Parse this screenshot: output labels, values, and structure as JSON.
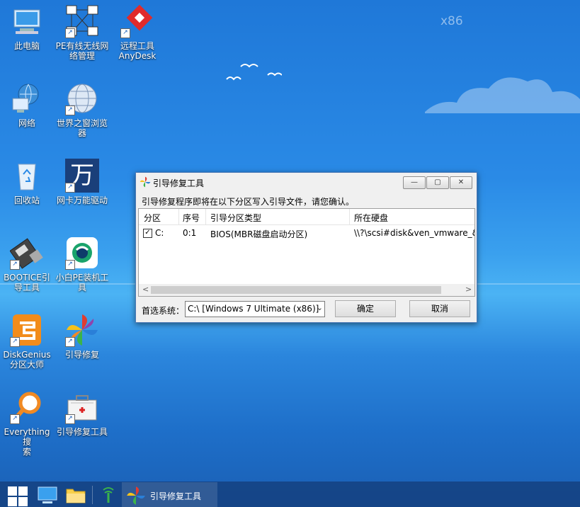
{
  "desktop": {
    "watermark": "x86",
    "icons": [
      {
        "label1": "此电脑",
        "label2": ""
      },
      {
        "label1": "PE有线无线网",
        "label2": "络管理"
      },
      {
        "label1": "远程工具",
        "label2": "AnyDesk"
      },
      {
        "label1": "网络",
        "label2": ""
      },
      {
        "label1": "世界之窗浏览",
        "label2": "器"
      },
      {
        "label1": "回收站",
        "label2": ""
      },
      {
        "label1": "网卡万能驱动",
        "label2": ""
      },
      {
        "label1": "BOOTICE引",
        "label2": "导工具"
      },
      {
        "label1": "小白PE装机工",
        "label2": "具"
      },
      {
        "label1": "DiskGenius",
        "label2": "分区大师"
      },
      {
        "label1": "引导修复",
        "label2": ""
      },
      {
        "label1": "Everything搜",
        "label2": "索"
      },
      {
        "label1": "引导修复工具",
        "label2": ""
      }
    ],
    "wan_glyph": "万"
  },
  "dialog": {
    "title": "引导修复工具",
    "prompt": "引导修复程序即将在以下分区写入引导文件，请您确认。",
    "columns": [
      "分区",
      "序号",
      "引导分区类型",
      "所在硬盘"
    ],
    "rows": [
      {
        "partition": "C:",
        "index": "0:1",
        "type": "BIOS(MBR磁盘启动分区)",
        "disk": "\\\\?\\scsi#disk&ven_vmware_&",
        "checked": true
      }
    ],
    "preferred_label": "首选系统：",
    "preferred_value": "C:\\ [Windows 7 Ultimate (x86)]",
    "ok": "确定",
    "cancel": "取消",
    "check_mark": "✓",
    "min_glyph": "—",
    "max_glyph": "▢",
    "close_glyph": "✕",
    "scroll_left": "<",
    "scroll_right": ">",
    "dropdown_glyph": "⌄"
  },
  "taskbar": {
    "active_title": "引导修复工具"
  }
}
